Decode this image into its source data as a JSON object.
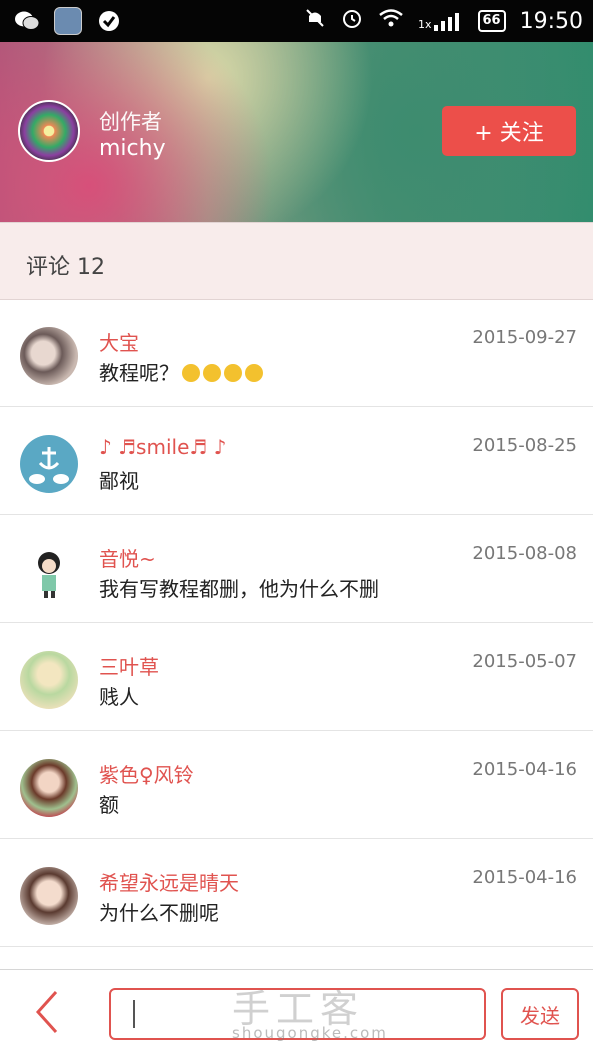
{
  "statusbar": {
    "time": "19:50",
    "battery": "66",
    "network": "1x",
    "icons_left": [
      "wechat-icon",
      "gallery-icon",
      "check-icon"
    ],
    "icons_right": [
      "mute-icon",
      "alarm-icon",
      "wifi-icon",
      "signal-icon",
      "battery-icon"
    ]
  },
  "header": {
    "creator_label": "创作者",
    "creator_name": "michy",
    "follow_label": "+ 关注"
  },
  "comments": {
    "heading": "评论 12",
    "items": [
      {
        "user": "大宝",
        "date": "2015-09-27",
        "text": "教程呢？",
        "emoji_count": 4
      },
      {
        "user": "♪ ♬smile♬ ♪",
        "date": "2015-08-25",
        "text": "鄙视"
      },
      {
        "user": "音悦~",
        "date": "2015-08-08",
        "text": "我有写教程都删，他为什么不删"
      },
      {
        "user": "三叶草",
        "date": "2015-05-07",
        "text": "贱人"
      },
      {
        "user": "紫色♀风铃",
        "date": "2015-04-16",
        "text": "额"
      },
      {
        "user": "希望永远是晴天",
        "date": "2015-04-16",
        "text": "为什么不删呢"
      }
    ]
  },
  "composer": {
    "send_label": "发送",
    "input_value": ""
  },
  "watermark": {
    "cn": "手工客",
    "en": "shougongke.com"
  },
  "colors": {
    "accent": "#e0534f",
    "follow_button": "#ec4f4a",
    "section_bg": "#f8eceb"
  }
}
